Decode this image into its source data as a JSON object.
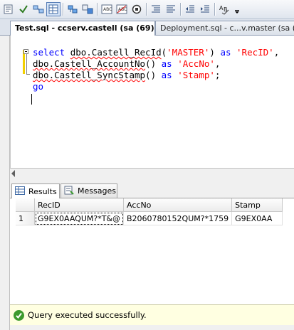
{
  "toolbar": {
    "buttons": [
      {
        "icon": "query-options-icon"
      },
      {
        "icon": "parse-icon"
      },
      {
        "icon": "include-plan-icon"
      },
      {
        "icon": "results-to-grid-icon"
      },
      {
        "icon": "results-to-file-icon"
      },
      {
        "icon": "client-statistics-icon"
      },
      {
        "icon": "comment-out-icon"
      },
      {
        "icon": "uncomment-icon"
      },
      {
        "icon": "decrease-indent-icon"
      },
      {
        "icon": "increase-indent-icon"
      },
      {
        "icon": "specify-template-values-icon"
      }
    ]
  },
  "tabs": [
    {
      "label": "Test.sql - ccserv.castell (sa (69))*",
      "active": true
    },
    {
      "label": "Deployment.sql - c...v.master (sa (68",
      "active": false
    }
  ],
  "editor": {
    "lines": [
      [
        {
          "t": "select",
          "c": "kw"
        },
        {
          "t": " ",
          "c": "plain"
        },
        {
          "t": "dbo.Castell_RecId",
          "c": "fn",
          "squig": true
        },
        {
          "t": "(",
          "c": "plain"
        },
        {
          "t": "'MASTER'",
          "c": "str"
        },
        {
          "t": ") ",
          "c": "plain"
        },
        {
          "t": "as",
          "c": "kw"
        },
        {
          "t": " ",
          "c": "plain"
        },
        {
          "t": "'RecID'",
          "c": "str"
        },
        {
          "t": ",",
          "c": "plain"
        }
      ],
      [
        {
          "t": "dbo.Castell_AccountNo",
          "c": "fn",
          "squig": true
        },
        {
          "t": "() ",
          "c": "plain"
        },
        {
          "t": "as",
          "c": "kw"
        },
        {
          "t": " ",
          "c": "plain"
        },
        {
          "t": "'AccNo'",
          "c": "str"
        },
        {
          "t": ",",
          "c": "plain"
        }
      ],
      [
        {
          "t": "dbo.Castell_SyncStamp",
          "c": "fn",
          "squig": true
        },
        {
          "t": "() ",
          "c": "plain"
        },
        {
          "t": "as",
          "c": "kw"
        },
        {
          "t": " ",
          "c": "plain"
        },
        {
          "t": "'Stamp'",
          "c": "str"
        },
        {
          "t": ";",
          "c": "plain"
        }
      ],
      [
        {
          "t": "go",
          "c": "kw"
        }
      ]
    ]
  },
  "results_tabs": [
    {
      "label": "Results",
      "icon": "grid-icon",
      "active": true
    },
    {
      "label": "Messages",
      "icon": "messages-icon",
      "active": false
    }
  ],
  "grid": {
    "columns": [
      "RecID",
      "AccNo",
      "Stamp"
    ],
    "rows": [
      {
        "num": "1",
        "cells": [
          "G9EX0AAQUM?*T&@",
          "B2060780152QUM?*1759",
          "G9EX0AA"
        ]
      }
    ]
  },
  "status": {
    "text": "Query executed successfully.",
    "icon": "check-circle-icon",
    "color": "#3c9a2e"
  }
}
